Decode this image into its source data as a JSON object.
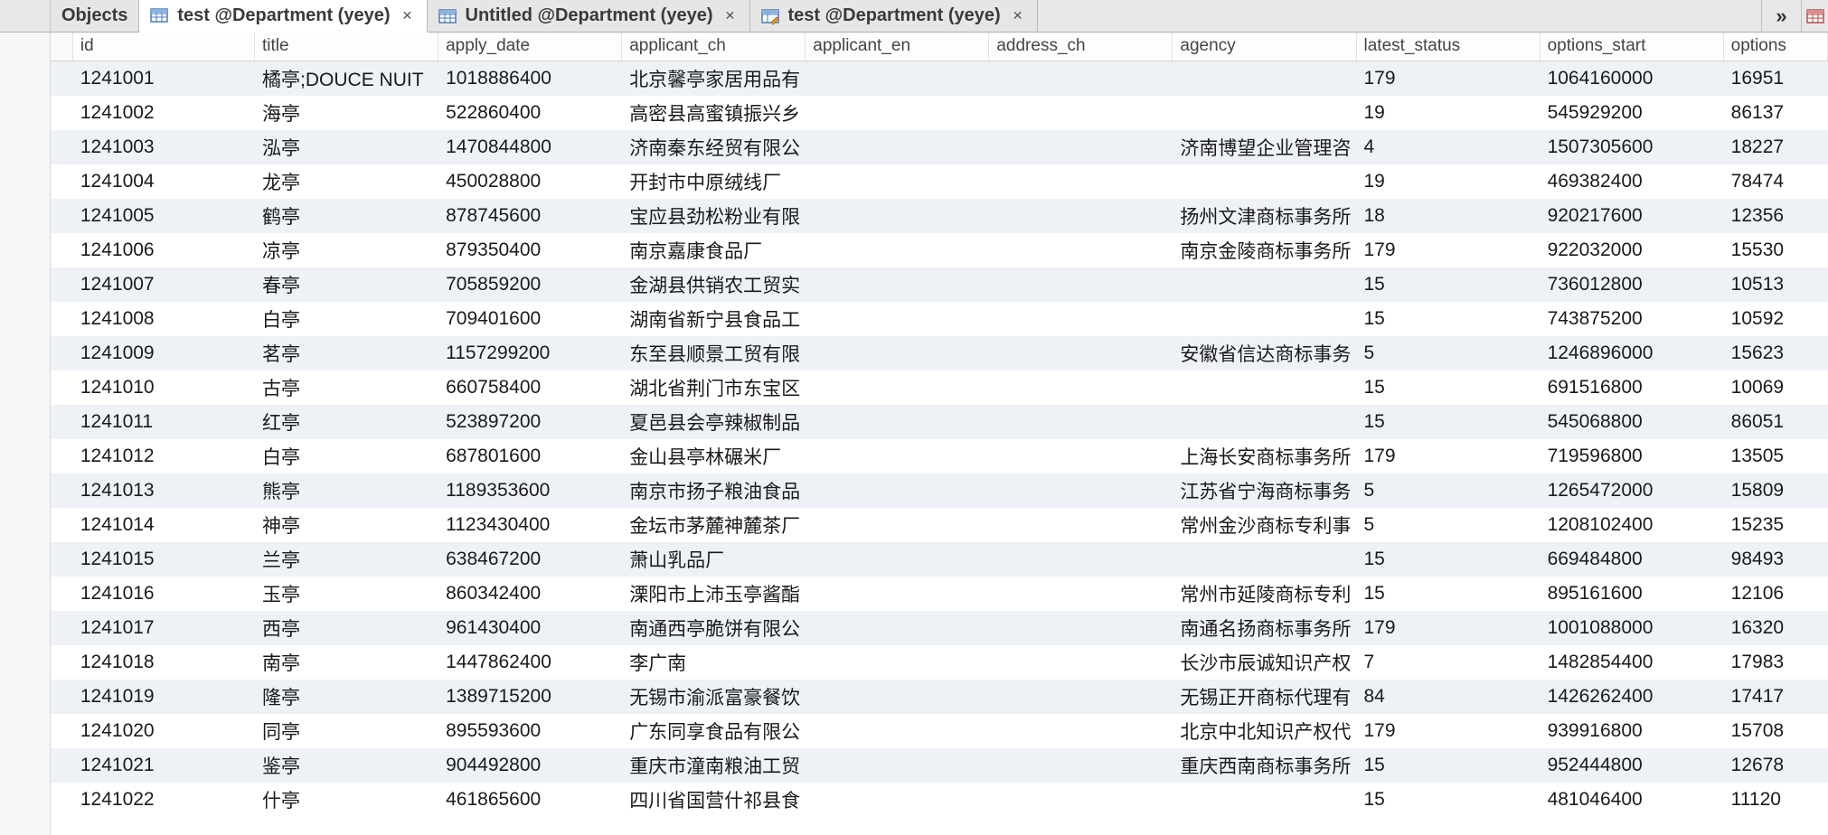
{
  "tabs": {
    "objects": "Objects",
    "t1": "test @Department (yeye)",
    "t2": "Untitled @Department (yeye)",
    "t3": "test @Department (yeye)",
    "overflow": "»"
  },
  "columns": [
    "id",
    "title",
    "apply_date",
    "applicant_ch",
    "applicant_en",
    "address_ch",
    "agency",
    "latest_status",
    "options_start",
    "options"
  ],
  "rows": [
    {
      "id": "1241001",
      "title": "橘亭;DOUCE NUIT",
      "apply_date": "1018886400",
      "applicant_ch": "北京馨亭家居用品有",
      "applicant_en": "",
      "address_ch": "",
      "agency": "",
      "latest_status": "179",
      "options_start": "1064160000",
      "options": "16951"
    },
    {
      "id": "1241002",
      "title": "海亭",
      "apply_date": "522860400",
      "applicant_ch": "高密县高蜜镇振兴乡",
      "applicant_en": "",
      "address_ch": "",
      "agency": "",
      "latest_status": "19",
      "options_start": "545929200",
      "options": "86137"
    },
    {
      "id": "1241003",
      "title": "泓亭",
      "apply_date": "1470844800",
      "applicant_ch": "济南秦东经贸有限公",
      "applicant_en": "",
      "address_ch": "",
      "agency": "济南博望企业管理咨",
      "latest_status": "4",
      "options_start": "1507305600",
      "options": "18227"
    },
    {
      "id": "1241004",
      "title": "龙亭",
      "apply_date": "450028800",
      "applicant_ch": "开封市中原绒线厂",
      "applicant_en": "",
      "address_ch": "",
      "agency": "",
      "latest_status": "19",
      "options_start": "469382400",
      "options": "78474"
    },
    {
      "id": "1241005",
      "title": "鹤亭",
      "apply_date": "878745600",
      "applicant_ch": "宝应县劲松粉业有限",
      "applicant_en": "",
      "address_ch": "",
      "agency": "扬州文津商标事务所",
      "latest_status": "18",
      "options_start": "920217600",
      "options": "12356"
    },
    {
      "id": "1241006",
      "title": "凉亭",
      "apply_date": "879350400",
      "applicant_ch": "南京嘉康食品厂",
      "applicant_en": "",
      "address_ch": "",
      "agency": "南京金陵商标事务所",
      "latest_status": "179",
      "options_start": "922032000",
      "options": "15530"
    },
    {
      "id": "1241007",
      "title": "春亭",
      "apply_date": "705859200",
      "applicant_ch": "金湖县供销农工贸实",
      "applicant_en": "",
      "address_ch": "",
      "agency": "",
      "latest_status": "15",
      "options_start": "736012800",
      "options": "10513"
    },
    {
      "id": "1241008",
      "title": "白亭",
      "apply_date": "709401600",
      "applicant_ch": "湖南省新宁县食品工",
      "applicant_en": "",
      "address_ch": "",
      "agency": "",
      "latest_status": "15",
      "options_start": "743875200",
      "options": "10592"
    },
    {
      "id": "1241009",
      "title": "茗亭",
      "apply_date": "1157299200",
      "applicant_ch": "东至县顺景工贸有限",
      "applicant_en": "",
      "address_ch": "",
      "agency": "安徽省信达商标事务",
      "latest_status": "5",
      "options_start": "1246896000",
      "options": "15623"
    },
    {
      "id": "1241010",
      "title": "古亭",
      "apply_date": "660758400",
      "applicant_ch": "湖北省荆门市东宝区",
      "applicant_en": "",
      "address_ch": "",
      "agency": "",
      "latest_status": "15",
      "options_start": "691516800",
      "options": "10069"
    },
    {
      "id": "1241011",
      "title": "红亭",
      "apply_date": "523897200",
      "applicant_ch": "夏邑县会亭辣椒制品",
      "applicant_en": "",
      "address_ch": "",
      "agency": "",
      "latest_status": "15",
      "options_start": "545068800",
      "options": "86051"
    },
    {
      "id": "1241012",
      "title": "白亭",
      "apply_date": "687801600",
      "applicant_ch": "金山县亭林碾米厂",
      "applicant_en": "",
      "address_ch": "",
      "agency": "上海长安商标事务所",
      "latest_status": "179",
      "options_start": "719596800",
      "options": "13505"
    },
    {
      "id": "1241013",
      "title": "熊亭",
      "apply_date": "1189353600",
      "applicant_ch": "南京市扬子粮油食品",
      "applicant_en": "",
      "address_ch": "",
      "agency": "江苏省宁海商标事务",
      "latest_status": "5",
      "options_start": "1265472000",
      "options": "15809"
    },
    {
      "id": "1241014",
      "title": "神亭",
      "apply_date": "1123430400",
      "applicant_ch": "金坛市茅麓神麓茶厂",
      "applicant_en": "",
      "address_ch": "",
      "agency": "常州金沙商标专利事",
      "latest_status": "5",
      "options_start": "1208102400",
      "options": "15235"
    },
    {
      "id": "1241015",
      "title": "兰亭",
      "apply_date": "638467200",
      "applicant_ch": "萧山乳品厂",
      "applicant_en": "",
      "address_ch": "",
      "agency": "",
      "latest_status": "15",
      "options_start": "669484800",
      "options": "98493"
    },
    {
      "id": "1241016",
      "title": "玉亭",
      "apply_date": "860342400",
      "applicant_ch": "溧阳市上沛玉亭酱酯",
      "applicant_en": "",
      "address_ch": "",
      "agency": "常州市延陵商标专利",
      "latest_status": "15",
      "options_start": "895161600",
      "options": "12106"
    },
    {
      "id": "1241017",
      "title": "西亭",
      "apply_date": "961430400",
      "applicant_ch": "南通西亭脆饼有限公",
      "applicant_en": "",
      "address_ch": "",
      "agency": "南通名扬商标事务所",
      "latest_status": "179",
      "options_start": "1001088000",
      "options": "16320"
    },
    {
      "id": "1241018",
      "title": "南亭",
      "apply_date": "1447862400",
      "applicant_ch": "李广南",
      "applicant_en": "",
      "address_ch": "",
      "agency": "长沙市辰诚知识产权",
      "latest_status": "7",
      "options_start": "1482854400",
      "options": "17983"
    },
    {
      "id": "1241019",
      "title": "隆亭",
      "apply_date": "1389715200",
      "applicant_ch": "无锡市渝派富豪餐饮",
      "applicant_en": "",
      "address_ch": "",
      "agency": "无锡正开商标代理有",
      "latest_status": "84",
      "options_start": "1426262400",
      "options": "17417"
    },
    {
      "id": "1241020",
      "title": "同亭",
      "apply_date": "895593600",
      "applicant_ch": "广东同享食品有限公",
      "applicant_en": "",
      "address_ch": "",
      "agency": "北京中北知识产权代",
      "latest_status": "179",
      "options_start": "939916800",
      "options": "15708"
    },
    {
      "id": "1241021",
      "title": "鉴亭",
      "apply_date": "904492800",
      "applicant_ch": "重庆市潼南粮油工贸",
      "applicant_en": "",
      "address_ch": "",
      "agency": "重庆西南商标事务所",
      "latest_status": "15",
      "options_start": "952444800",
      "options": "12678"
    },
    {
      "id": "1241022",
      "title": "什亭",
      "apply_date": "461865600",
      "applicant_ch": "四川省国营什祁县食",
      "applicant_en": "",
      "address_ch": "",
      "agency": "",
      "latest_status": "15",
      "options_start": "481046400",
      "options": "11120"
    }
  ]
}
